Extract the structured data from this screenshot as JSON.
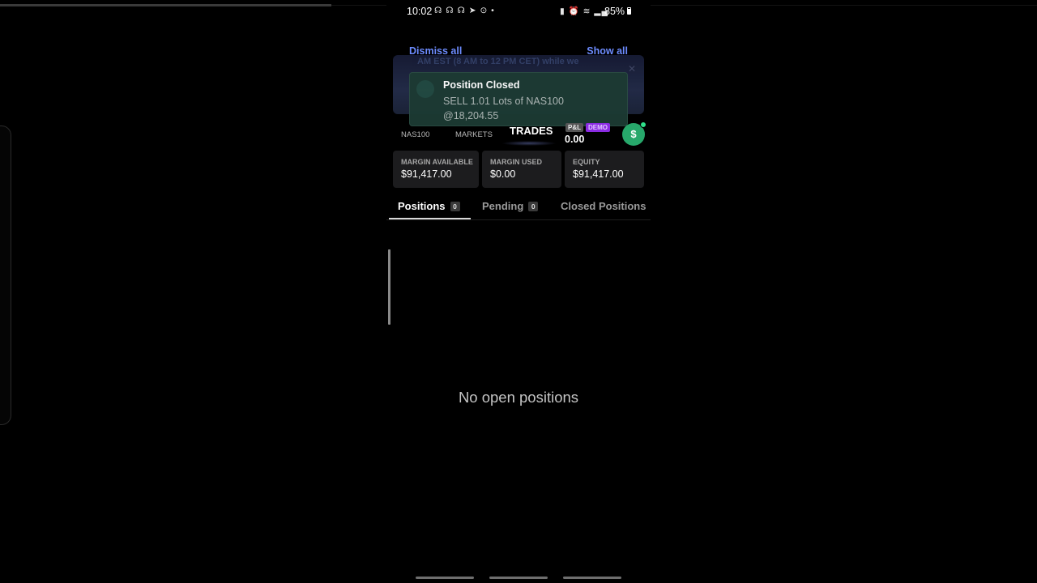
{
  "status_bar": {
    "time": "10:02",
    "left_icons": "☊ ☊ ☊ ➤ ⊙ •",
    "right_icons": "▮ ⏰ ≋ ▂▄",
    "battery": "85%"
  },
  "notification_shade": {
    "dismiss_all": "Dismiss all",
    "show_all": "Show all"
  },
  "banner": {
    "text": "AM EST (8 AM to 12 PM CET) while we"
  },
  "notification": {
    "title": "Position Closed",
    "body": "SELL  1.01 Lots of NAS100 @18,204.55"
  },
  "nav": {
    "symbol": "NAS100",
    "markets": "MARKETS",
    "trades": "TRADES",
    "pl_badge": "P&L",
    "demo_badge": "DEMO",
    "pl_value": "0.00",
    "wallet_symbol": "$"
  },
  "account": {
    "margin_available_label": "MARGIN AVAILABLE",
    "margin_available_value": "$91,417.00",
    "margin_used_label": "MARGIN USED",
    "margin_used_value": "$0.00",
    "equity_label": "EQUITY",
    "equity_value": "$91,417.00"
  },
  "tabs": {
    "positions": "Positions",
    "positions_count": "0",
    "pending": "Pending",
    "pending_count": "0",
    "closed": "Closed Positions",
    "active": "positions"
  },
  "empty_state": "No open positions",
  "colors": {
    "accent_link": "#6d8cff",
    "wallet_green": "#27a86b",
    "demo_purple": "#8a2be2",
    "notification_bg": "#1c3a33"
  }
}
